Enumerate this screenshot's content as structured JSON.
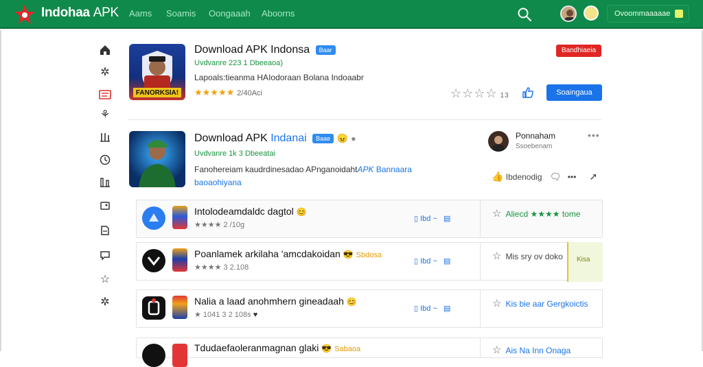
{
  "header": {
    "brand": "Indohaa",
    "brand_suffix": "APK",
    "nav": [
      "Aams",
      "Soamis",
      "Oongaaah",
      "Aboorns"
    ],
    "cta_label": "Ovoommaaaaae"
  },
  "featured": {
    "title": "Download APK Indonsa",
    "badge": "Baar",
    "meta": "Uvdvanre 223 1 Dbeeaoa)",
    "description": "Lapoals:tieanma HAIodoraan Bolana Indoaabr",
    "rating_stars": "★★★★★",
    "rating_count": "2/40Aci",
    "icon_text": "FANORKSIA!",
    "red_badge": "Bandhiaeia",
    "outline_rating": "☆☆☆☆",
    "outline_count": "13",
    "action_button": "Soaingaua"
  },
  "second": {
    "title_a": "Download APK",
    "title_b": "Indanai",
    "badge": "Baae",
    "meta": "Uvdvanre 1k 3 Dbeeatai",
    "description_1": "Fanohereiam kaudrdinesadao APnganoidaht",
    "description_2": "APK",
    "description_3": "Bannaara",
    "description_4": "baoaohiyana",
    "developer_name": "Ponnaham",
    "developer_sub": "Ssoebenam",
    "more": "•••",
    "action_like": "Ibdenodig",
    "action_comment": "•••"
  },
  "rows": [
    {
      "title": "Intolodeamdaldc dagtol",
      "tag": "",
      "rating": "★★★★ 2 /10g",
      "mid": "Ibd ~",
      "right_text": "Aliecd ★★★★ tome",
      "right_color": "#18933f"
    },
    {
      "title": "Poanlamek arkilaha 'amcdakoidan",
      "tag": "Sbdosa",
      "rating": "★★★★ 3 2.108",
      "mid": "Ibd ~",
      "right_text": "Mis sry ov doko",
      "right_color": "#444444",
      "panel_label": "Kisa"
    },
    {
      "title": "Nalia a laad anohmhern gineadaah",
      "tag": "",
      "rating": "★ 1041 3 2 108s",
      "mid": "Ibd ~",
      "right_text": "Kis bie aar Gergkoictis",
      "right_color": "#1a73e8"
    },
    {
      "title": "Tdudaefaoleranmagnan glaki",
      "tag": "Sabaoa",
      "rating": "",
      "mid": "",
      "right_text": "Ais Na Inn Onaga",
      "right_color": "#1a73e8"
    }
  ],
  "colors": {
    "topbar": "#0f8a4b",
    "accent_blue": "#1a73e8",
    "accent_red": "#e02624",
    "star": "#f2a10c"
  }
}
